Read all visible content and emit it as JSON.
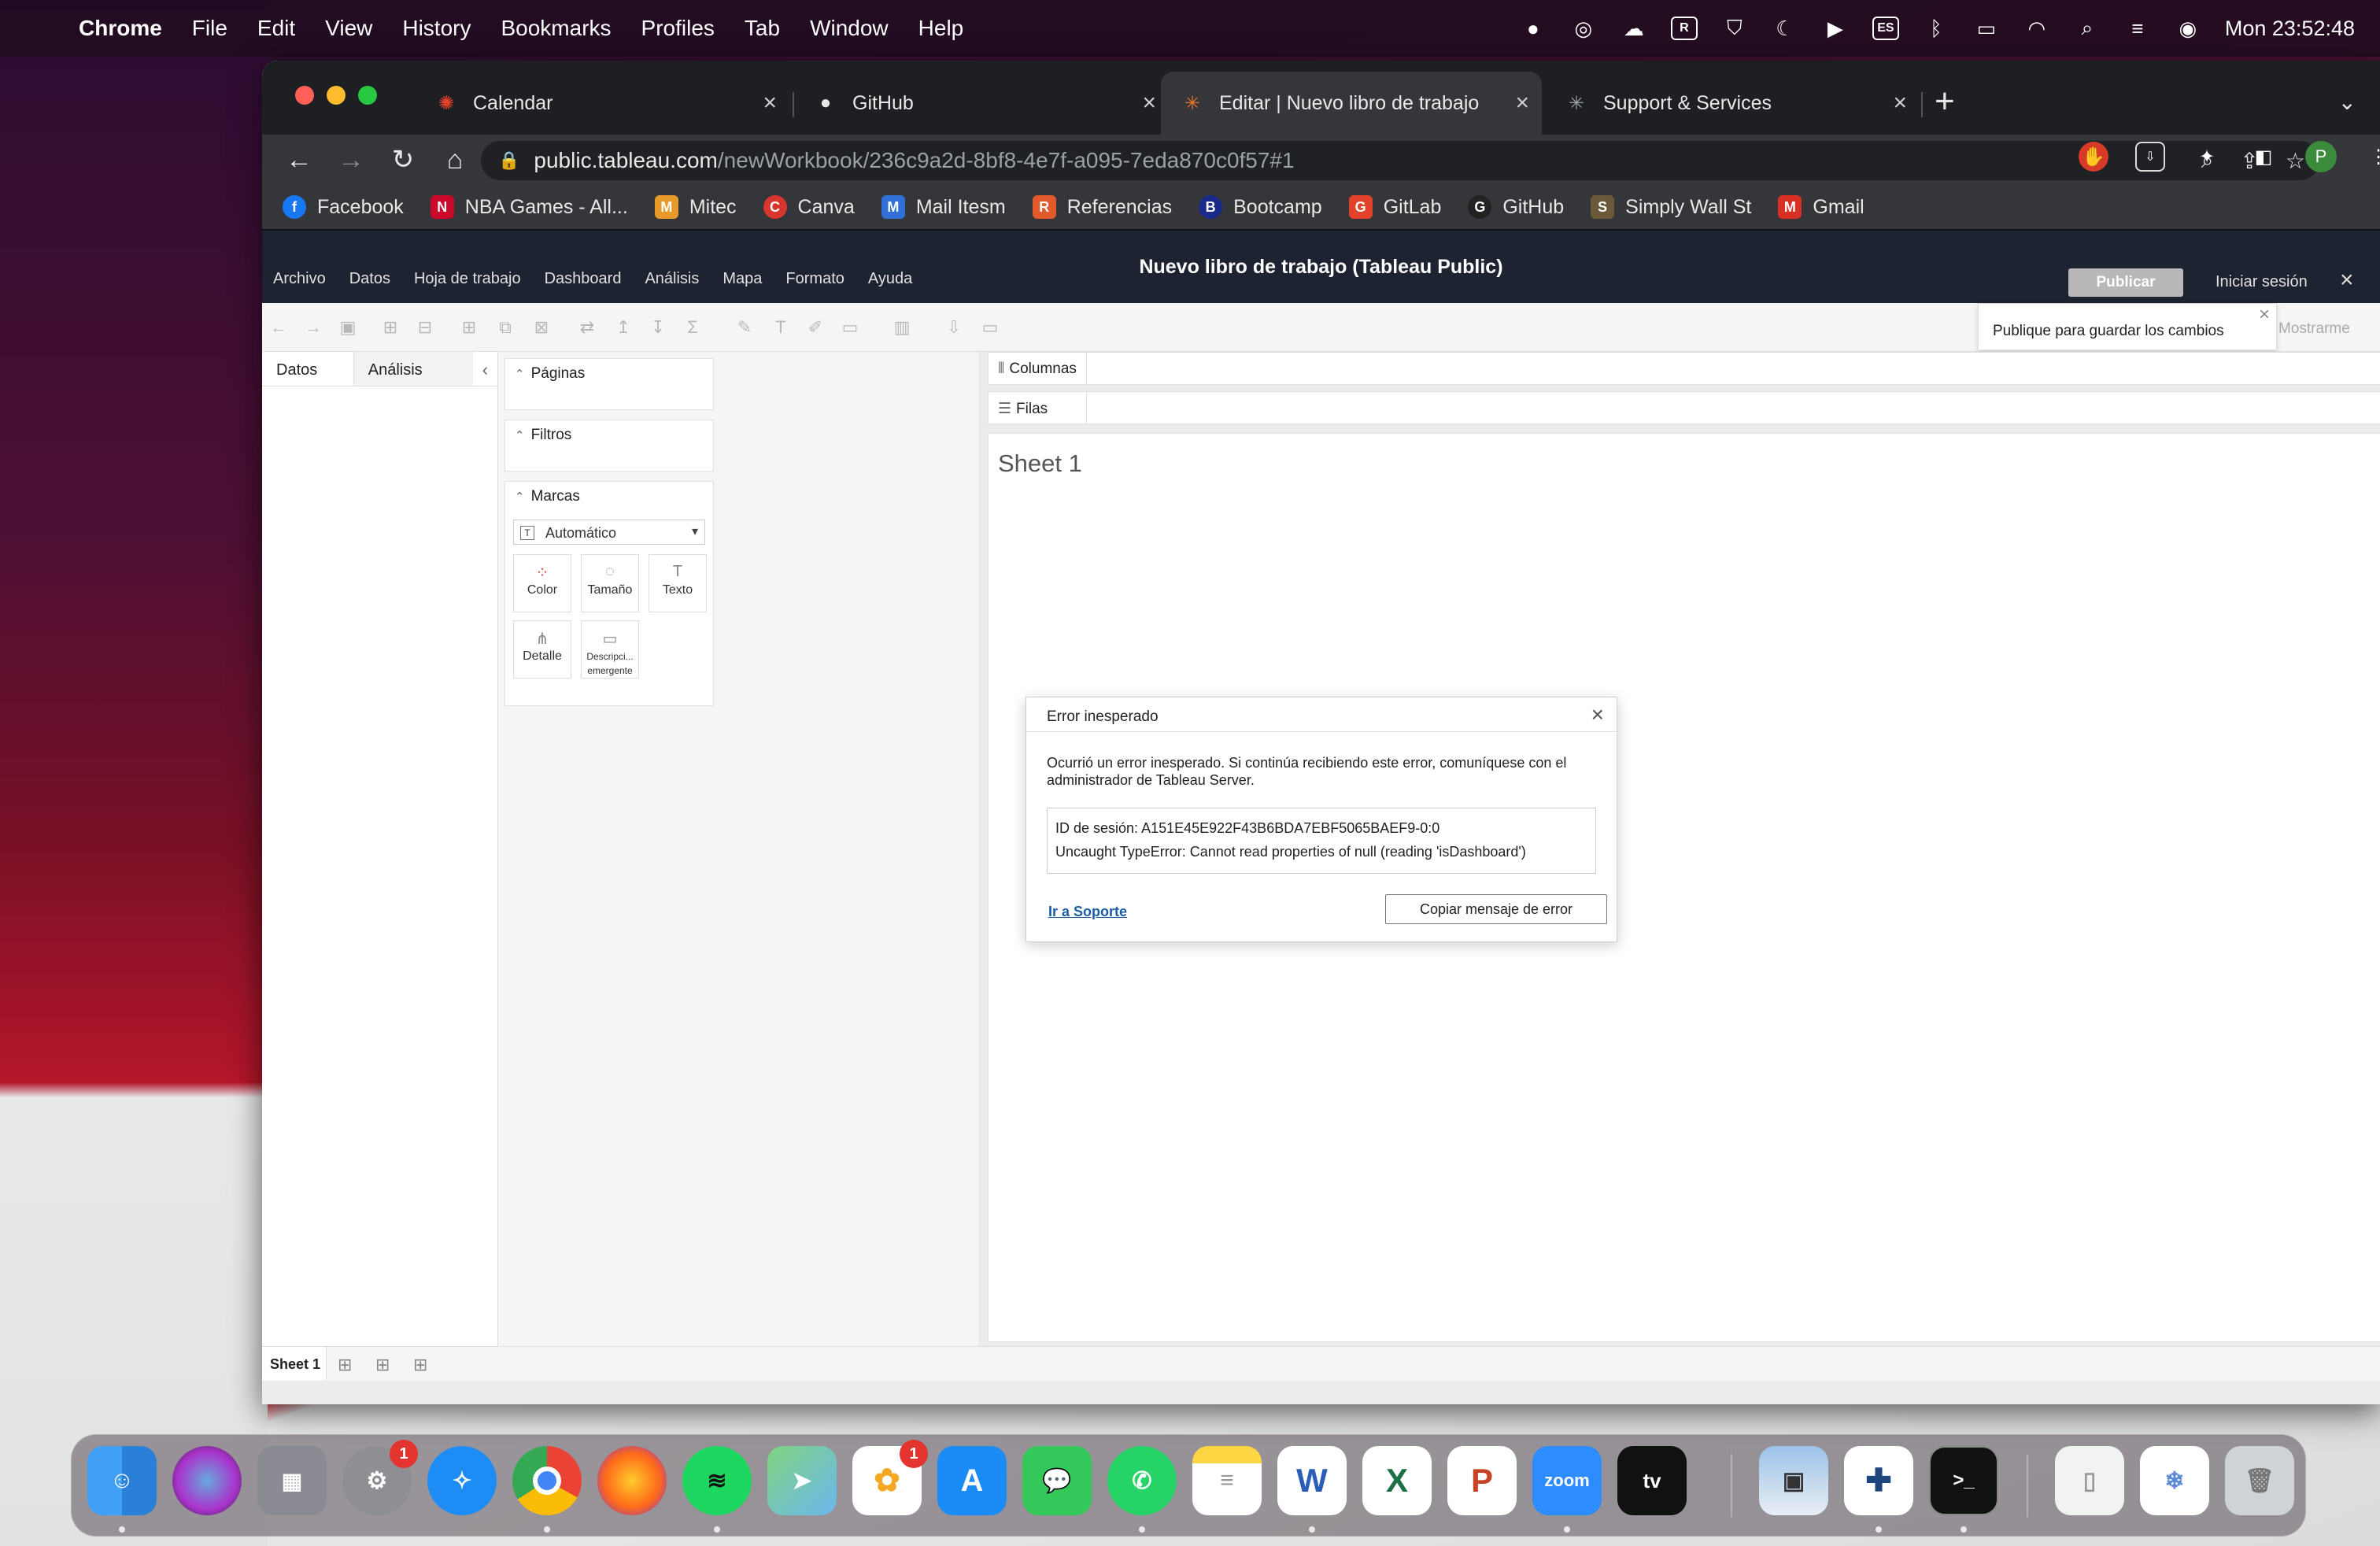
{
  "menubar": {
    "apple": "",
    "items": [
      "Chrome",
      "File",
      "Edit",
      "View",
      "History",
      "Bookmarks",
      "Profiles",
      "Tab",
      "Window",
      "Help"
    ],
    "clock": "Mon  23:52:48",
    "input_source": "ES"
  },
  "browser": {
    "tabs": [
      {
        "label": "Calendar",
        "icon": "calendar-favicon"
      },
      {
        "label": "GitHub",
        "icon": "github-icon"
      },
      {
        "label": "Editar | Nuevo libro de trabajo",
        "icon": "tableau-icon"
      },
      {
        "label": "Support & Services",
        "icon": "tableau-icon"
      }
    ],
    "url_host": "public.tableau.com",
    "url_path": "/newWorkbook/236c9a2d-8bf8-4e7f-a095-7eda870c0f57#1",
    "profile_initial": "P",
    "bookmarks": [
      {
        "label": "Facebook",
        "color": "#1877f2",
        "glyph": "f"
      },
      {
        "label": "NBA Games - All...",
        "color": "#c9082a",
        "glyph": "N"
      },
      {
        "label": "Mitec",
        "color": "#e89b2b",
        "glyph": "M"
      },
      {
        "label": "Canva",
        "color": "#d9352f",
        "glyph": "C"
      },
      {
        "label": "Mail Itesm",
        "color": "#2f6fd6",
        "glyph": "M"
      },
      {
        "label": "Referencias",
        "color": "#e05a2b",
        "glyph": "R"
      },
      {
        "label": "Bootcamp",
        "color": "#1a2a8a",
        "glyph": "B"
      },
      {
        "label": "GitLab",
        "color": "#e2432a",
        "glyph": "G"
      },
      {
        "label": "GitHub",
        "color": "#222222",
        "glyph": "G"
      },
      {
        "label": "Simply Wall St",
        "color": "#6b5a3a",
        "glyph": "S"
      },
      {
        "label": "Gmail",
        "color": "#d93025",
        "glyph": "M"
      }
    ]
  },
  "tableau": {
    "menu": [
      "Archivo",
      "Datos",
      "Hoja de trabajo",
      "Dashboard",
      "Análisis",
      "Mapa",
      "Formato",
      "Ayuda"
    ],
    "title": "Nuevo libro de trabajo (Tableau Public)",
    "publish": "Publicar",
    "sign_in": "Iniciar sesión",
    "tooltip": "Publique para guardar los cambios",
    "show_me": "Mostrarme",
    "left_tabs": [
      "Datos",
      "Análisis"
    ],
    "cards": {
      "pages": "Páginas",
      "filters": "Filtros",
      "marks": "Marcas",
      "mark_type": "Automático",
      "mark_buttons": [
        "Color",
        "Tamaño",
        "Texto",
        "Detalle",
        "Descripci... emergente"
      ]
    },
    "shelves": {
      "columns": "Columnas",
      "rows": "Filas"
    },
    "sheet_title": "Sheet 1",
    "sheet_tab": "Sheet 1"
  },
  "dialog": {
    "title": "Error inesperado",
    "message": "Ocurrió un error inesperado. Si continúa recibiendo este error, comuníquese con el administrador de Tableau Server.",
    "session_id": "ID de sesión: A151E45E922F43B6BDA7EBF5065BAEF9-0:0",
    "error": "Uncaught TypeError: Cannot read properties of null (reading 'isDashboard')",
    "link": "Ir a Soporte",
    "copy_button": "Copiar mensaje de error"
  },
  "dock": {
    "badges": {
      "settings": "1",
      "photos": "1"
    },
    "zoom_label": "zoom",
    "tv_label": "tv"
  }
}
